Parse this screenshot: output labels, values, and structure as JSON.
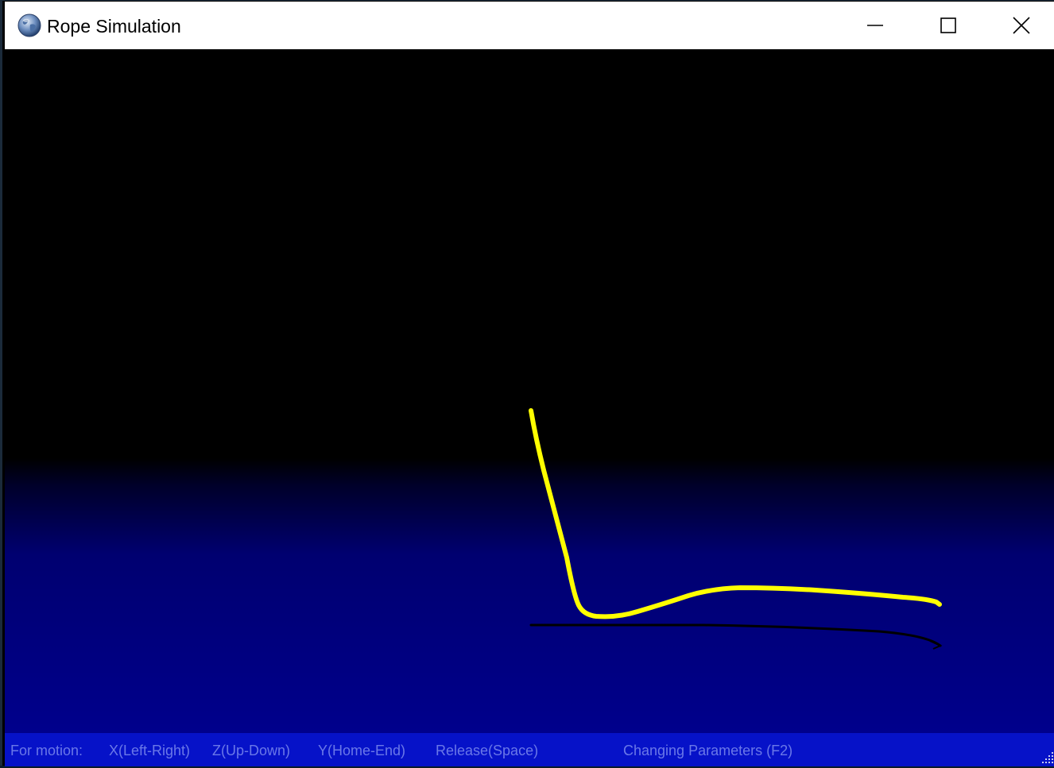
{
  "window": {
    "title": "Rope Simulation",
    "icon": "globe-icon",
    "controls": [
      "minimize-icon",
      "maximize-icon",
      "close-icon"
    ]
  },
  "scene": {
    "sky_color": "#000000",
    "ground_color": "#00008c",
    "rope_color": "#ffff00",
    "shadow_color": "#000000"
  },
  "statusbar": {
    "background": "#0612c8",
    "text_color": "#6a78e8",
    "items": [
      "For motion:",
      "X(Left-Right)",
      "Z(Up-Down)",
      "Y(Home-End)",
      "Release(Space)",
      "Changing Parameters (F2)"
    ]
  }
}
